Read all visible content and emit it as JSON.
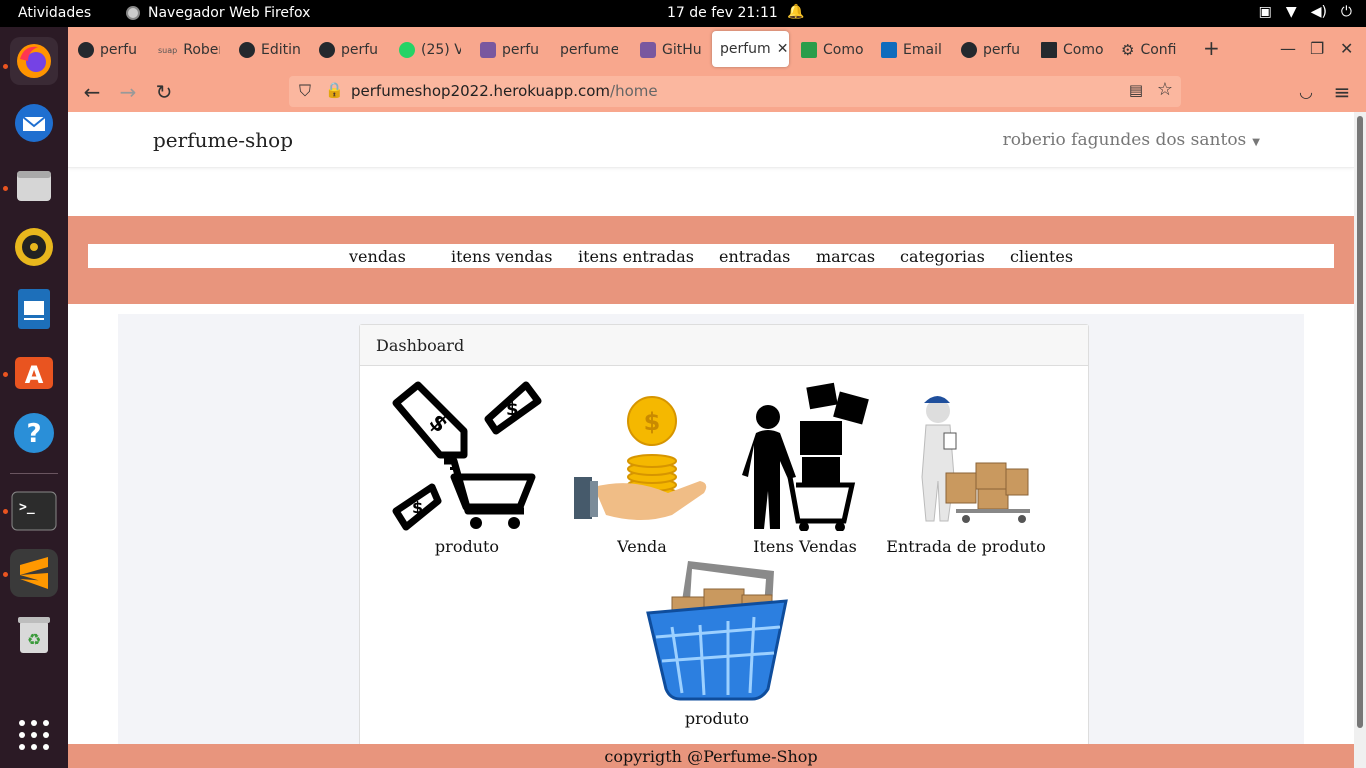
{
  "system": {
    "activities": "Atividades",
    "app_name": "Navegador Web Firefox",
    "clock": "17 de fev  21:11"
  },
  "browser": {
    "tabs": [
      {
        "label": "perfu",
        "icon": "github-icon"
      },
      {
        "label": "Rober",
        "icon": "suap-icon"
      },
      {
        "label": "Editin",
        "icon": "github-icon"
      },
      {
        "label": "perfu",
        "icon": "github-icon"
      },
      {
        "label": "(25) V",
        "icon": "whatsapp-icon"
      },
      {
        "label": "perfu",
        "icon": "heroku-icon"
      },
      {
        "label": "perfume",
        "icon": ""
      },
      {
        "label": "GitHu",
        "icon": "heroku-icon"
      },
      {
        "label": "perfum",
        "icon": "",
        "active": true
      },
      {
        "label": "Como",
        "icon": "stackoverflow-icon"
      },
      {
        "label": "Email",
        "icon": "outlook-icon"
      },
      {
        "label": "perfu",
        "icon": "github-icon"
      },
      {
        "label": "Como",
        "icon": "page-icon"
      },
      {
        "label": "Confi",
        "icon": "gear-icon"
      }
    ],
    "url_host": "perfumeshop2022.herokuapp.com",
    "url_path": "/home"
  },
  "site": {
    "brand": "perfume-shop",
    "user": "roberio fagundes dos santos",
    "menu": [
      "vendas",
      "itens vendas",
      "itens entradas",
      "entradas",
      "marcas",
      "categorias",
      "clientes"
    ],
    "dashboard_title": "Dashboard",
    "tiles": [
      "produto",
      "Venda",
      "Itens Vendas",
      "Entrada de produto",
      "produto"
    ],
    "footer": "copyrigth @Perfume-Shop"
  },
  "colors": {
    "browser_chrome": "#f8a78d",
    "menu_band": "#e8957d",
    "dock": "#2b1a25"
  }
}
